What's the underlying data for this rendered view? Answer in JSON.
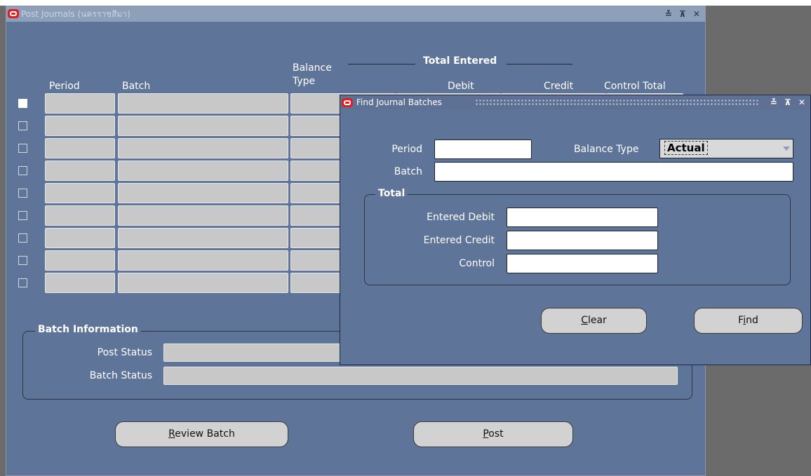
{
  "main_window": {
    "title": "Post Journals (นครราชสีมา)",
    "controls": "≚ ⊼ ✕",
    "columns": {
      "period": "Period",
      "batch": "Batch",
      "balance_type_line1": "Balance",
      "balance_type_line2": "Type",
      "total_entered": "Total Entered",
      "debit": "Debit",
      "credit": "Credit",
      "control_total": "Control Total"
    },
    "batch_information": {
      "title": "Batch Information",
      "post_status_label": "Post Status",
      "batch_status_label": "Batch Status"
    },
    "buttons": {
      "review_batch_mnemonic": "R",
      "review_batch_rest": "eview Batch",
      "post_mnemonic": "P",
      "post_rest": "ost"
    }
  },
  "find_dialog": {
    "title": "Find Journal Batches",
    "controls": "≚ ⊼ ✕",
    "period_label": "Period",
    "balance_type_label": "Balance Type",
    "balance_type_value": "Actual",
    "batch_label": "Batch",
    "total_group_title": "Total",
    "entered_debit_label": "Entered Debit",
    "entered_credit_label": "Entered Credit",
    "control_label": "Control",
    "buttons": {
      "clear_mnemonic": "C",
      "clear_rest": "lear",
      "find_pre": "F",
      "find_mnemonic": "i",
      "find_post": "nd"
    }
  },
  "colors": {
    "window_bg": "#5f7499",
    "desktop": "#6b6b6b",
    "readonly_field": "#c8c8c8",
    "logo_red": "#e02020"
  }
}
